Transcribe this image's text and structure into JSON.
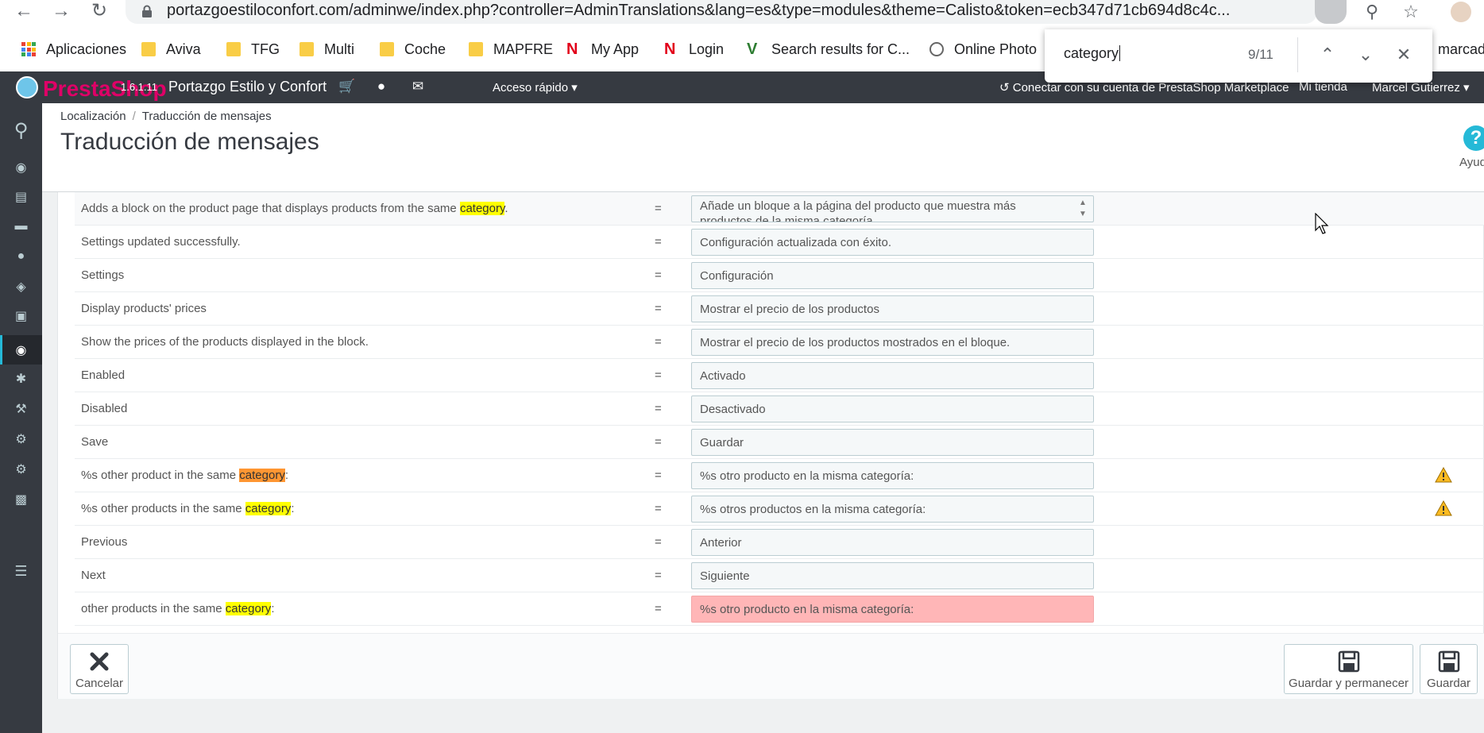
{
  "browser": {
    "url": "portazgoestiloconfort.com/adminwe/index.php?controller=AdminTranslations&lang=es&type=modules&theme=Calisto&token=ecb347d71cb694d8c4c...",
    "bookmarks": [
      {
        "label": "Aplicaciones",
        "icon": "apps-icon"
      },
      {
        "label": "Aviva",
        "icon": "folder-icon"
      },
      {
        "label": "TFG",
        "icon": "folder-icon"
      },
      {
        "label": "Multi",
        "icon": "folder-icon"
      },
      {
        "label": "Coche",
        "icon": "folder-icon"
      },
      {
        "label": "MAPFRE",
        "icon": "folder-icon"
      },
      {
        "label": "My App",
        "icon": "n-logo-icon"
      },
      {
        "label": "Login",
        "icon": "n-logo-icon"
      },
      {
        "label": "Search results for C...",
        "icon": "v-logo-icon"
      },
      {
        "label": "Online Photo",
        "icon": "aperture-icon"
      },
      {
        "label": "marcado",
        "icon": "page-icon"
      }
    ],
    "find": {
      "query": "category",
      "count": "9/11"
    }
  },
  "header": {
    "logo_text": "PrestaShop",
    "version": "1.6.1.11",
    "shop_name": "Portazgo Estilo y Confort",
    "quick_access": "Acceso rápido",
    "connect": "Conectar con su cuenta de PrestaShop Marketplace",
    "my_shop": "Mi tienda",
    "user": "Marcel Gutierrez"
  },
  "breadcrumb": {
    "parent": "Localización",
    "sep": "/",
    "current": "Traducción de mensajes"
  },
  "page": {
    "title": "Traducción de mensajes",
    "help": "Ayuda"
  },
  "rows": [
    {
      "pre": "Adds a block on the product page that displays products from the same ",
      "mark": "category",
      "post": ".",
      "current": false,
      "eq": "=",
      "value": "Añade un bloque a la página del producto que muestra más productos de la misma categoría",
      "warn": false,
      "error": false,
      "textarea": true
    },
    {
      "pre": "Settings updated successfully.",
      "mark": "",
      "post": "",
      "current": false,
      "eq": "=",
      "value": "Configuración actualizada con éxito.",
      "warn": false,
      "error": false
    },
    {
      "pre": "Settings",
      "mark": "",
      "post": "",
      "current": false,
      "eq": "=",
      "value": "Configuración",
      "warn": false,
      "error": false
    },
    {
      "pre": "Display products' prices",
      "mark": "",
      "post": "",
      "current": false,
      "eq": "=",
      "value": "Mostrar el precio de los productos",
      "warn": false,
      "error": false
    },
    {
      "pre": "Show the prices of the products displayed in the block.",
      "mark": "",
      "post": "",
      "current": false,
      "eq": "=",
      "value": "Mostrar el precio de los productos mostrados en el bloque.",
      "warn": false,
      "error": false
    },
    {
      "pre": "Enabled",
      "mark": "",
      "post": "",
      "current": false,
      "eq": "=",
      "value": "Activado",
      "warn": false,
      "error": false
    },
    {
      "pre": "Disabled",
      "mark": "",
      "post": "",
      "current": false,
      "eq": "=",
      "value": "Desactivado",
      "warn": false,
      "error": false
    },
    {
      "pre": "Save",
      "mark": "",
      "post": "",
      "current": false,
      "eq": "=",
      "value": "Guardar",
      "warn": false,
      "error": false
    },
    {
      "pre": "%s other product in the same ",
      "mark": "category",
      "post": ":",
      "current": true,
      "eq": "=",
      "value": "%s otro producto en la misma categoría:",
      "warn": true,
      "error": false
    },
    {
      "pre": "%s other products in the same ",
      "mark": "category",
      "post": ":",
      "current": false,
      "eq": "=",
      "value": "%s otros productos en la misma categoría:",
      "warn": true,
      "error": false
    },
    {
      "pre": "Previous",
      "mark": "",
      "post": "",
      "current": false,
      "eq": "=",
      "value": "Anterior",
      "warn": false,
      "error": false
    },
    {
      "pre": "Next",
      "mark": "",
      "post": "",
      "current": false,
      "eq": "=",
      "value": "Siguiente",
      "warn": false,
      "error": false
    },
    {
      "pre": "other products in the same ",
      "mark": "category",
      "post": ":",
      "current": false,
      "eq": "=",
      "value": "%s otro producto en la misma categoría:",
      "warn": false,
      "error": true
    }
  ],
  "footer": {
    "cancel": "Cancelar",
    "save_stay": "Guardar y permanecer",
    "save": "Guardar"
  },
  "sidebar_icons": [
    "search-icon",
    "dashboard-icon",
    "orders-icon",
    "catalog-icon",
    "customers-icon",
    "price-rules-icon",
    "shipping-icon",
    "localization-icon",
    "modules-icon",
    "preferences-icon",
    "advanced-params-icon",
    "administration-icon",
    "stats-icon",
    "menu-collapse-icon"
  ],
  "colors": {
    "highlight": "#ffff00",
    "current_highlight": "#ff9632",
    "error_bg": "#ffb6b7",
    "accent": "#25b9d7",
    "header_bg": "#363a41"
  }
}
